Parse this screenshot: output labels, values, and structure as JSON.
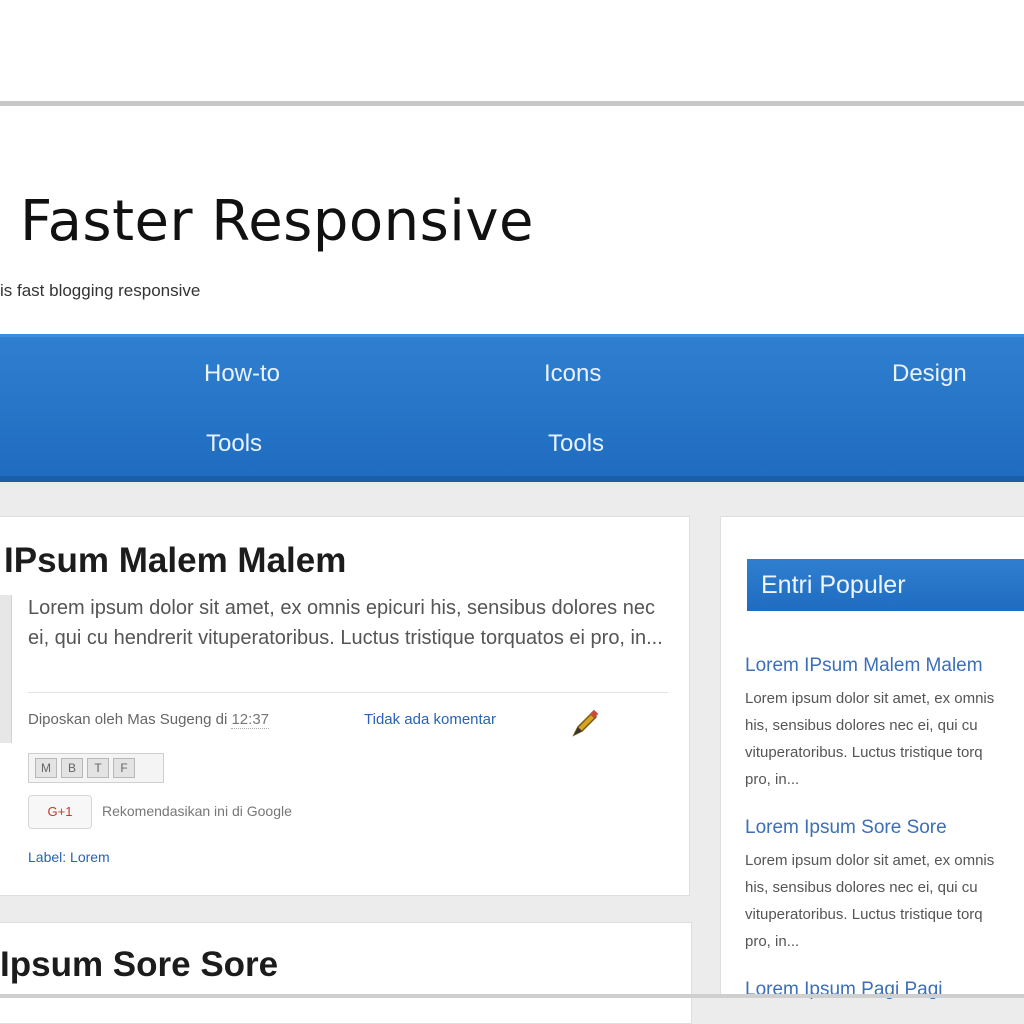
{
  "header": {
    "site_title": "Faster Responsive",
    "tagline": "is fast blogging responsive"
  },
  "nav": {
    "items": [
      "How-to",
      "Icons",
      "Design",
      "Tools",
      "Tools"
    ]
  },
  "post": {
    "title": "IPsum Malem Malem",
    "excerpt": "Lorem ipsum dolor sit amet, ex omnis epicuri his, sensibus dolores nec ei, qui cu hendrerit vituperatoribus. Luctus tristique torquatos ei pro, in...",
    "meta_prefix": "Diposkan oleh Mas Sugeng di",
    "meta_date": "12:37",
    "comment_link": "Tidak ada komentar",
    "edit_icon": "pencil-icon",
    "share_buttons": [
      "M",
      "B",
      "T",
      "F"
    ],
    "gplus_label": "G+1",
    "gplus_text": "Rekomendasikan ini di Google",
    "categories": "Label: Lorem"
  },
  "post2": {
    "title": "Ipsum Sore Sore"
  },
  "sidebar": {
    "widget_title": "Entri Populer",
    "items": [
      {
        "link": "Lorem IPsum Malem Malem",
        "text": "Lorem ipsum dolor sit amet, ex omnis\nhis, sensibus dolores nec ei, qui cu\nvituperatoribus. Luctus tristique torq\npro, in..."
      },
      {
        "link": "Lorem Ipsum Sore Sore",
        "text": "Lorem ipsum dolor sit amet, ex omnis\nhis, sensibus dolores nec ei, qui cu\nvituperatoribus. Luctus tristique torq\npro, in..."
      },
      {
        "link": "Lorem Ipsum Pagi Pagi",
        "text": ""
      }
    ]
  },
  "colors": {
    "nav_blue": "#1f6cc0",
    "link_blue": "#2a62b4",
    "page_bg": "#ececec"
  }
}
